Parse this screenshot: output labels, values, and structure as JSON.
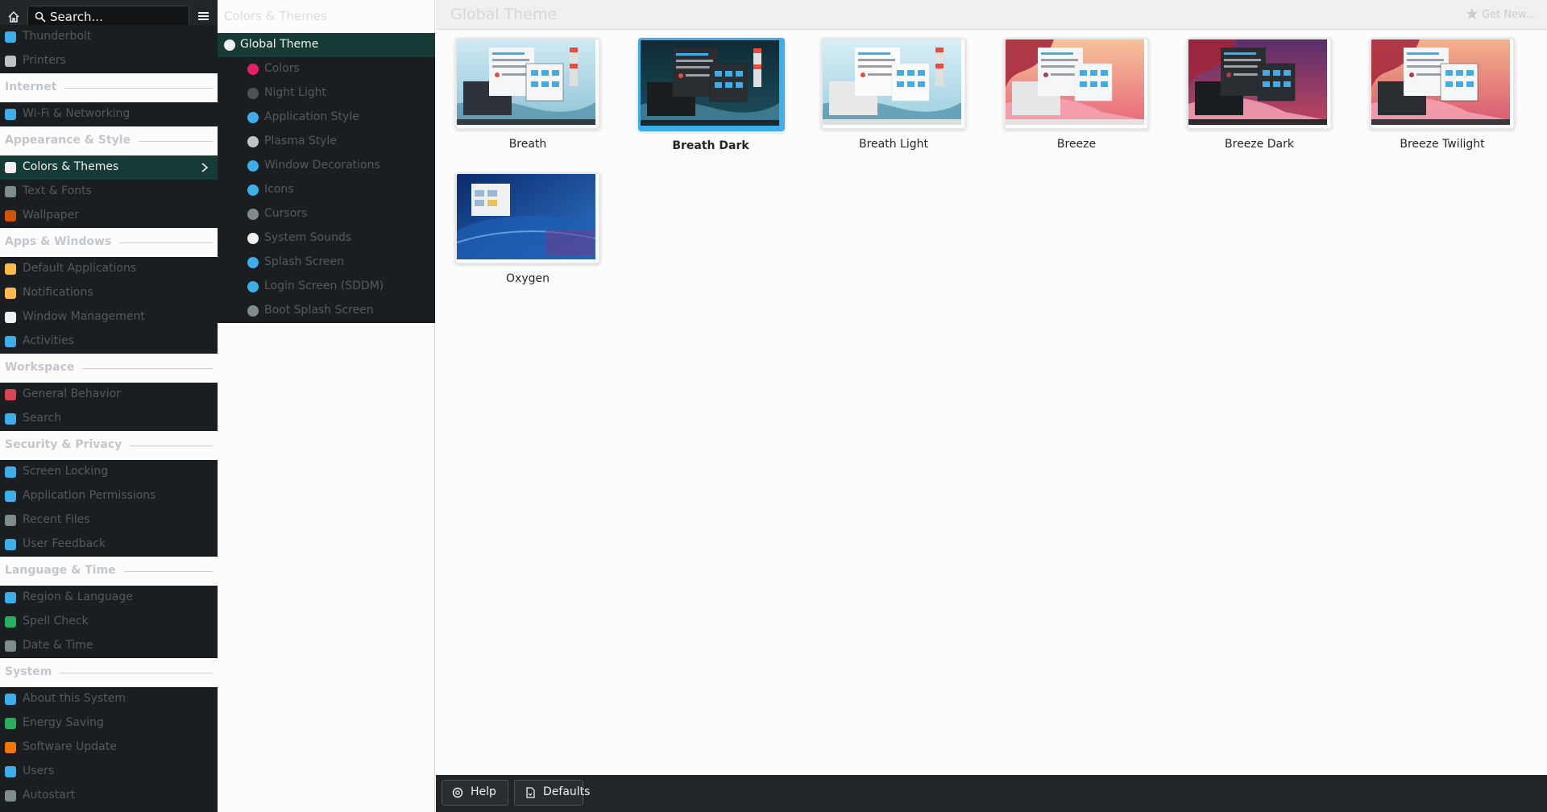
{
  "sidebar": {
    "search_placeholder": "Search...",
    "sections": [
      {
        "items": [
          {
            "label": "Thunderbolt",
            "color": "#3daee9"
          },
          {
            "label": "Printers",
            "color": "#bdc3c7"
          }
        ]
      },
      {
        "heading": "Internet",
        "items": [
          {
            "label": "Wi-Fi & Networking",
            "color": "#3daee9"
          }
        ]
      },
      {
        "heading": "Appearance & Style",
        "items": [
          {
            "label": "Colors & Themes",
            "color": "#eff0f1",
            "active": true
          },
          {
            "label": "Text & Fonts",
            "color": "#7f8c8d"
          },
          {
            "label": "Wallpaper",
            "color": "#d35400"
          }
        ]
      },
      {
        "heading": "Apps & Windows",
        "items": [
          {
            "label": "Default Applications",
            "color": "#fdbc4b"
          },
          {
            "label": "Notifications",
            "color": "#fdbc4b"
          },
          {
            "label": "Window Management",
            "color": "#eff0f1"
          },
          {
            "label": "Activities",
            "color": "#3daee9"
          }
        ]
      },
      {
        "heading": "Workspace",
        "items": [
          {
            "label": "General Behavior",
            "color": "#da4453"
          },
          {
            "label": "Search",
            "color": "#3daee9"
          }
        ]
      },
      {
        "heading": "Security & Privacy",
        "items": [
          {
            "label": "Screen Locking",
            "color": "#3daee9"
          },
          {
            "label": "Application Permissions",
            "color": "#3daee9"
          },
          {
            "label": "Recent Files",
            "color": "#7f8c8d"
          },
          {
            "label": "User Feedback",
            "color": "#3daee9"
          }
        ]
      },
      {
        "heading": "Language & Time",
        "items": [
          {
            "label": "Region & Language",
            "color": "#3daee9"
          },
          {
            "label": "Spell Check",
            "color": "#27ae60"
          },
          {
            "label": "Date & Time",
            "color": "#7f8c8d"
          }
        ]
      },
      {
        "heading": "System",
        "items": [
          {
            "label": "About this System",
            "color": "#3daee9"
          },
          {
            "label": "Energy Saving",
            "color": "#27ae60"
          },
          {
            "label": "Software Update",
            "color": "#f67400"
          },
          {
            "label": "Users",
            "color": "#3daee9"
          },
          {
            "label": "Autostart",
            "color": "#7f8c8d"
          }
        ]
      }
    ]
  },
  "middle": {
    "title": "Colors & Themes",
    "items": [
      {
        "label": "Global Theme",
        "color": "#eff0f1",
        "active": true
      },
      {
        "label": "Colors",
        "color": "#e91e63"
      },
      {
        "label": "Night Light",
        "color": "#4d5257"
      },
      {
        "label": "Application Style",
        "color": "#3daee9"
      },
      {
        "label": "Plasma Style",
        "color": "#bdc3c7"
      },
      {
        "label": "Window Decorations",
        "color": "#3daee9"
      },
      {
        "label": "Icons",
        "color": "#3daee9"
      },
      {
        "label": "Cursors",
        "color": "#7f8c8d"
      },
      {
        "label": "System Sounds",
        "color": "#eff0f1"
      },
      {
        "label": "Splash Screen",
        "color": "#3daee9"
      },
      {
        "label": "Login Screen (SDDM)",
        "color": "#3daee9"
      },
      {
        "label": "Boot Splash Screen",
        "color": "#7f8c8d"
      }
    ]
  },
  "main": {
    "title": "Global Theme",
    "get_new": "Get New...",
    "themes": [
      {
        "name": "Breath",
        "style": "light-sea"
      },
      {
        "name": "Breath Dark",
        "style": "dark-sea",
        "selected": true
      },
      {
        "name": "Breath Light",
        "style": "light-sea2"
      },
      {
        "name": "Breeze",
        "style": "sunset-light"
      },
      {
        "name": "Breeze Dark",
        "style": "sunset-dark"
      },
      {
        "name": "Breeze Twilight",
        "style": "sunset-mixed"
      },
      {
        "name": "Oxygen",
        "style": "oxygen"
      }
    ],
    "help_label": "Help",
    "defaults_label": "Defaults"
  }
}
